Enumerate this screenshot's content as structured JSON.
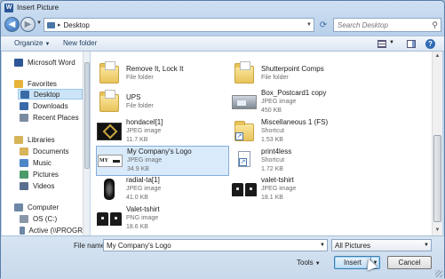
{
  "window": {
    "title": "Insert Picture",
    "app_icon": "W"
  },
  "address": {
    "path": "Desktop",
    "search_placeholder": "Search Desktop"
  },
  "toolbar": {
    "organize": "Organize",
    "new_folder": "New folder",
    "help": "?"
  },
  "nav": {
    "items": [
      {
        "label": "Microsoft Word",
        "icon": "word-icon",
        "color": "#2b5797"
      },
      {
        "label": "Favorites",
        "icon": "star-icon",
        "color": "#e8b33a"
      },
      {
        "label": "Desktop",
        "icon": "desktop-icon",
        "color": "#3a6aa8",
        "selected": true
      },
      {
        "label": "Downloads",
        "icon": "downloads-icon",
        "color": "#3a6aa8"
      },
      {
        "label": "Recent Places",
        "icon": "recent-places-icon",
        "color": "#7a8aa0"
      },
      {
        "label": "Libraries",
        "icon": "libraries-icon",
        "color": "#d7b35a"
      },
      {
        "label": "Documents",
        "icon": "documents-icon",
        "color": "#d7b35a"
      },
      {
        "label": "Music",
        "icon": "music-icon",
        "color": "#4a86c8"
      },
      {
        "label": "Pictures",
        "icon": "pictures-icon",
        "color": "#4a9a6a"
      },
      {
        "label": "Videos",
        "icon": "videos-icon",
        "color": "#5a6f8f"
      },
      {
        "label": "Computer",
        "icon": "computer-icon",
        "color": "#6f87a6"
      },
      {
        "label": "OS (C:)",
        "icon": "drive-icon",
        "color": "#8a97a8"
      },
      {
        "label": "Active (\\\\PROGR",
        "icon": "network-drive-icon",
        "color": "#6f87a6"
      }
    ]
  },
  "files": [
    {
      "name": "Remove It, Lock It",
      "type": "File folder",
      "size": "",
      "kind": "folder"
    },
    {
      "name": "Shutterpoint Comps",
      "type": "File folder",
      "size": "",
      "kind": "folder"
    },
    {
      "name": "UPS",
      "type": "File folder",
      "size": "",
      "kind": "folder"
    },
    {
      "name": "Box_Postcard1 copy",
      "type": "JPEG image",
      "size": "450 KB",
      "kind": "postcard"
    },
    {
      "name": "hondacel[1]",
      "type": "JPEG image",
      "size": "11.7 KB",
      "kind": "dark"
    },
    {
      "name": "Miscellaneous 1 (FS)",
      "type": "Shortcut",
      "size": "1.53 KB",
      "kind": "shortcut-folder"
    },
    {
      "name": "My Company's Logo",
      "type": "JPEG image",
      "size": "34.9 KB",
      "kind": "logo",
      "selected": true,
      "logo_text": "MY"
    },
    {
      "name": "print4less",
      "type": "Shortcut",
      "size": "1.72 KB",
      "kind": "shortcut-doc"
    },
    {
      "name": "radial-ta[1]",
      "type": "JPEG image",
      "size": "41.0 KB",
      "kind": "tire"
    },
    {
      "name": "valet-tshirt",
      "type": "JPEG image",
      "size": "18.1 KB",
      "kind": "shirt"
    },
    {
      "name": "Valet-tshirt",
      "type": "PNG image",
      "size": "18.6 KB",
      "kind": "shirt"
    }
  ],
  "bottom": {
    "file_name_label": "File name:",
    "file_name_value": "My Company's Logo",
    "filter_value": "All Pictures",
    "tools_label": "Tools",
    "insert_label": "Insert",
    "cancel_label": "Cancel"
  }
}
